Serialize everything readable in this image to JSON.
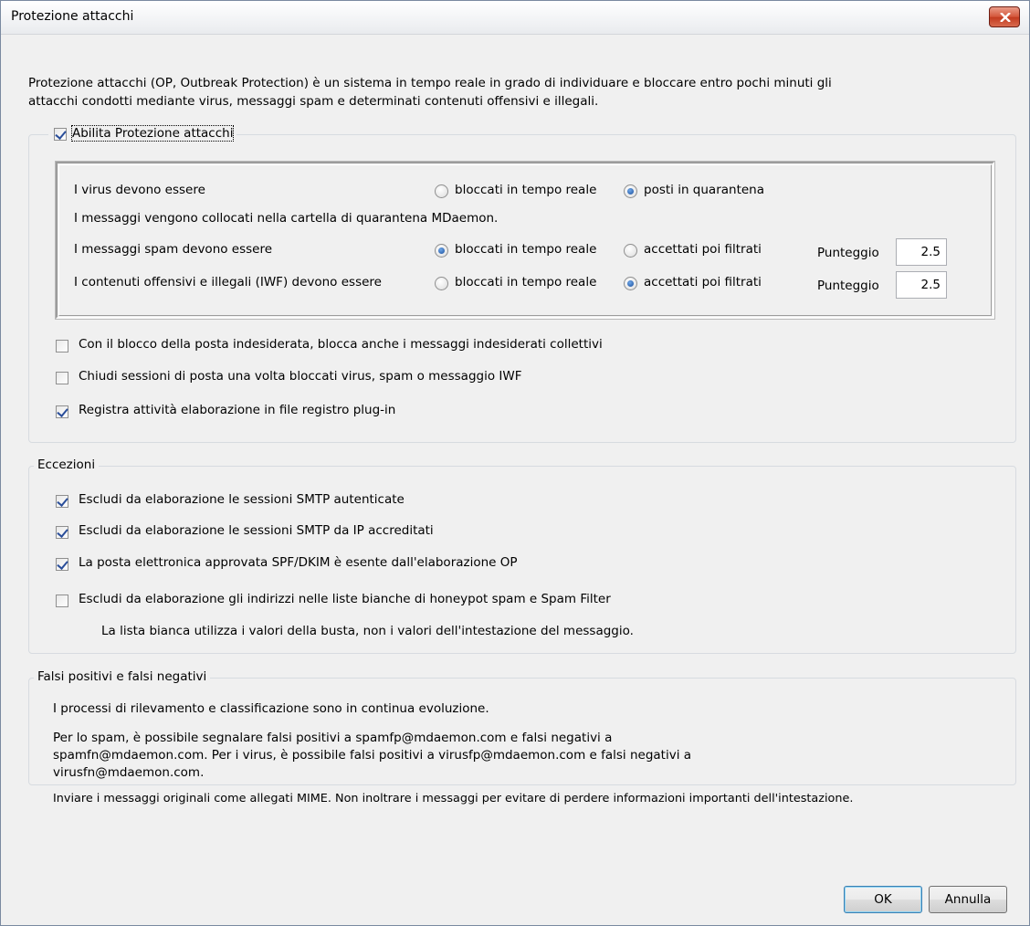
{
  "window": {
    "title": "Protezione attacchi"
  },
  "description": {
    "line1": "Protezione attacchi (OP, Outbreak Protection) è un sistema in tempo reale in grado di individuare e bloccare entro pochi minuti gli",
    "line2": "attacchi condotti mediante virus, messaggi spam e determinati contenuti offensivi e illegali."
  },
  "enable_group": {
    "enable_label": "Abilita Protezione attacchi",
    "enable_checked": true,
    "virus": {
      "label": "I virus devono essere",
      "option_block": "bloccati in tempo reale",
      "option_quarantine": "posti in quarantena",
      "selected": "posti in quarantena"
    },
    "quarantine_note": "I messaggi vengono collocati nella cartella di quarantena MDaemon.",
    "spam": {
      "label": "I messaggi spam devono essere",
      "option_block": "bloccati in tempo reale",
      "option_accept": "accettati poi filtrati",
      "selected": "bloccati in tempo reale",
      "score_label": "Punteggio",
      "score_value": "2.5"
    },
    "iwf": {
      "label": "I contenuti offensivi e illegali (IWF) devono essere",
      "option_block": "bloccati in tempo reale",
      "option_accept": "accettati poi filtrati",
      "selected": "accettati poi filtrati",
      "score_label": "Punteggio",
      "score_value": "2.5"
    },
    "options": [
      {
        "label": "Con il blocco della posta indesiderata, blocca anche i messaggi indesiderati collettivi",
        "checked": false
      },
      {
        "label": "Chiudi sessioni di posta una volta bloccati virus, spam o messaggio IWF",
        "checked": false
      },
      {
        "label": "Registra attività elaborazione in file registro plug-in",
        "checked": true
      }
    ]
  },
  "exceptions": {
    "legend": "Eccezioni",
    "options": [
      {
        "label": "Escludi da elaborazione le sessioni SMTP autenticate",
        "checked": true
      },
      {
        "label": "Escludi da elaborazione le sessioni SMTP da IP accreditati",
        "checked": true
      },
      {
        "label": "La posta elettronica approvata SPF/DKIM è esente dall'elaborazione OP",
        "checked": true
      },
      {
        "label": "Escludi da elaborazione gli indirizzi nelle liste bianche di honeypot spam e Spam Filter",
        "checked": false
      }
    ],
    "note": "La lista bianca utilizza i valori della busta, non i valori dell'intestazione del messaggio."
  },
  "false_positives": {
    "legend": "Falsi positivi e falsi negativi",
    "para1": "I processi di rilevamento e classificazione sono in continua evoluzione.",
    "para2_line1": "Per lo spam, è possibile segnalare falsi positivi a spamfp@mdaemon.com e falsi negativi a",
    "para2_line2": "spamfn@mdaemon.com. Per i virus, è possibile falsi positivi a virusfp@mdaemon.com e falsi negativi a",
    "para2_line3": "virusfn@mdaemon.com.",
    "para3": "Inviare i messaggi originali come allegati MIME. Non inoltrare i messaggi per evitare di perdere informazioni importanti dell'intestazione."
  },
  "buttons": {
    "ok": "OK",
    "cancel": "Annulla"
  }
}
